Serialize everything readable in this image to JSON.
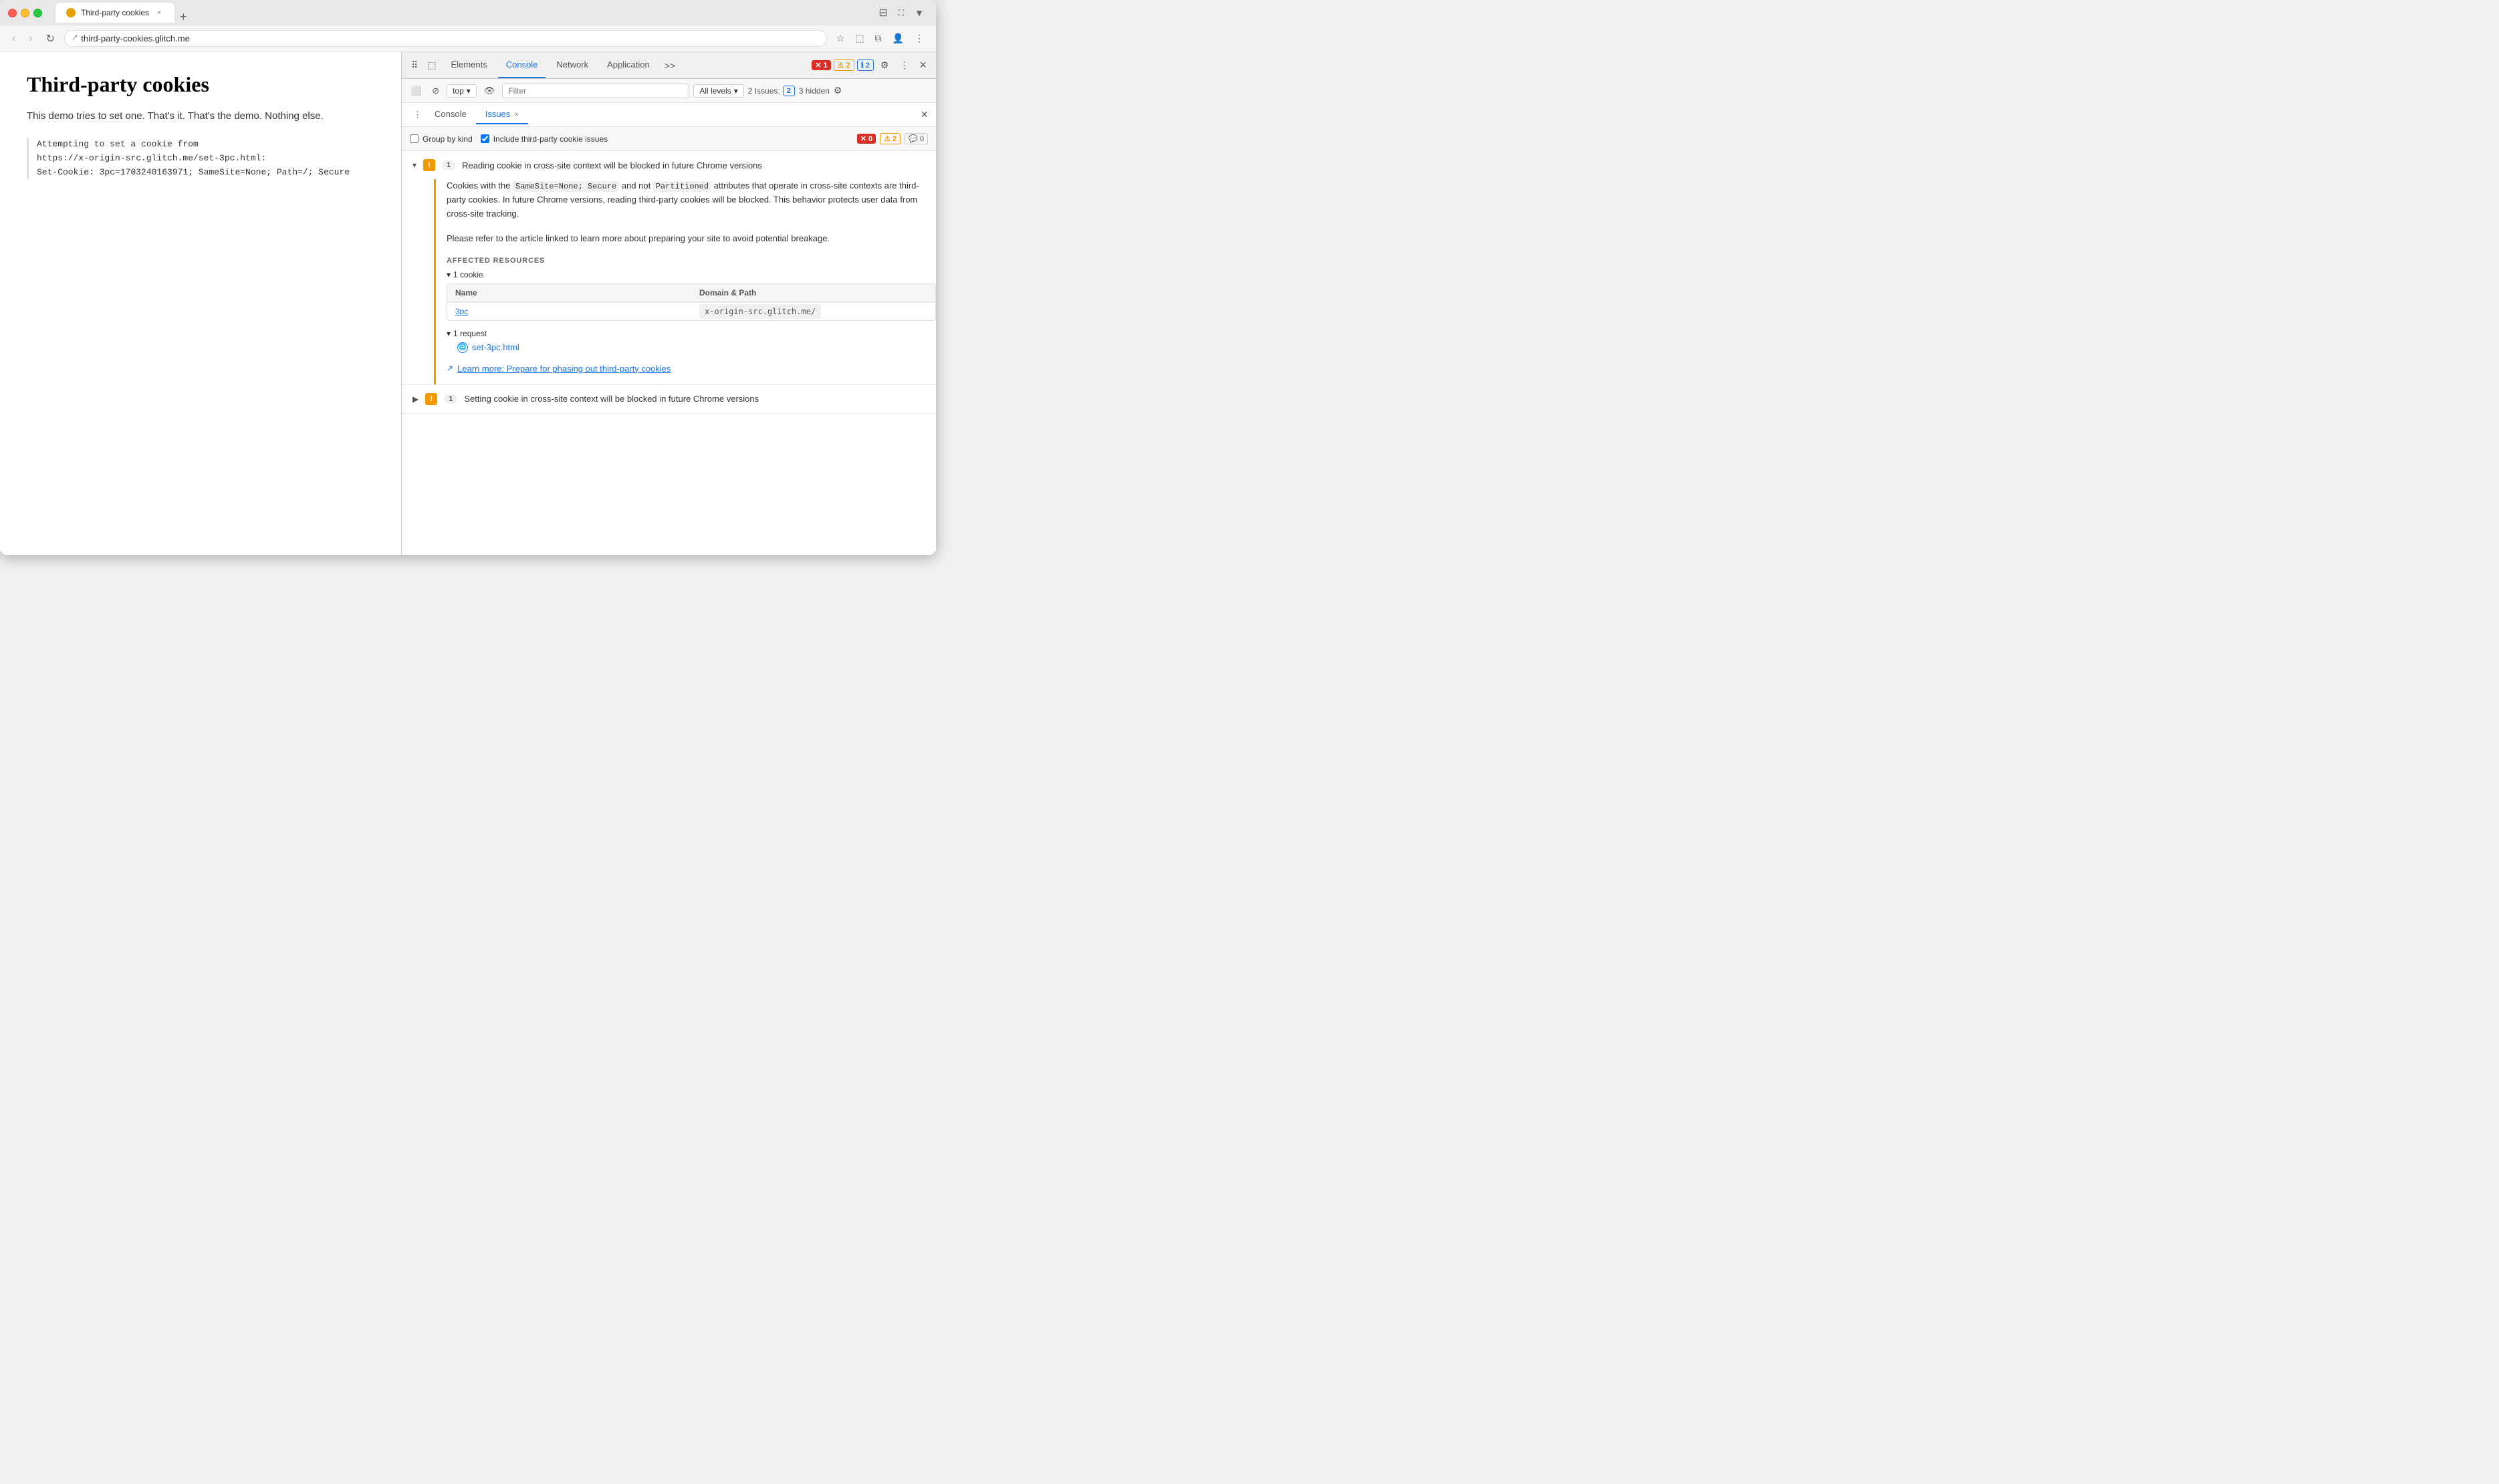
{
  "browser": {
    "tab_title": "Third-party cookies",
    "url": "third-party-cookies.glitch.me",
    "new_tab_label": "+"
  },
  "page": {
    "title": "Third-party cookies",
    "description": "This demo tries to set one. That's it. That's the demo. Nothing else.",
    "console_line1": "Attempting to set a cookie from",
    "console_line2": "https://x-origin-src.glitch.me/set-3pc.html:",
    "console_line3": "Set-Cookie: 3pc=1703240163971; SameSite=None; Path=/; Secure"
  },
  "devtools": {
    "tabs": [
      "Elements",
      "Console",
      "Network",
      "Application"
    ],
    "active_tab": "Console",
    "error_count": "1",
    "warn_count": "2",
    "info_count": "2",
    "more_tabs": ">>",
    "close_label": "×",
    "toolbar": {
      "top_label": "top",
      "filter_placeholder": "Filter",
      "levels_label": "All levels",
      "issues_label": "2 Issues:",
      "issues_num": "2",
      "hidden_label": "3 hidden"
    }
  },
  "issues_panel": {
    "tabs": [
      {
        "label": "Console",
        "active": false
      },
      {
        "label": "Issues",
        "active": true
      }
    ],
    "toolbar": {
      "group_by_kind": "Group by kind",
      "include_third_party": "Include third-party cookie issues",
      "error_count": "0",
      "warn_count": "2",
      "info_count": "0"
    },
    "issues": [
      {
        "id": 1,
        "expanded": true,
        "count": "1",
        "title": "Reading cookie in cross-site context will be blocked in future Chrome versions",
        "description_p1": "Cookies with the SameSite=None; Secure and not Partitioned attributes that operate in cross-site contexts are third-party cookies. In future Chrome versions, reading third-party cookies will be blocked. This behavior protects user data from cross-site tracking.",
        "description_p2": "Please refer to the article linked to learn more about preparing your site to avoid potential breakage.",
        "affected_resources_title": "AFFECTED RESOURCES",
        "cookie_toggle": "▾ 1 cookie",
        "cookie_name_col": "Name",
        "cookie_domain_col": "Domain & Path",
        "cookie_name": "3pc",
        "cookie_domain": "x-origin-src.glitch.me/",
        "request_toggle": "▾ 1 request",
        "request_link": "set-3pc.html",
        "learn_more_text": "Learn more: Prepare for phasing out third-party cookies",
        "learn_more_url": "#"
      },
      {
        "id": 2,
        "expanded": false,
        "count": "1",
        "title": "Setting cookie in cross-site context will be blocked in future Chrome versions"
      }
    ]
  }
}
